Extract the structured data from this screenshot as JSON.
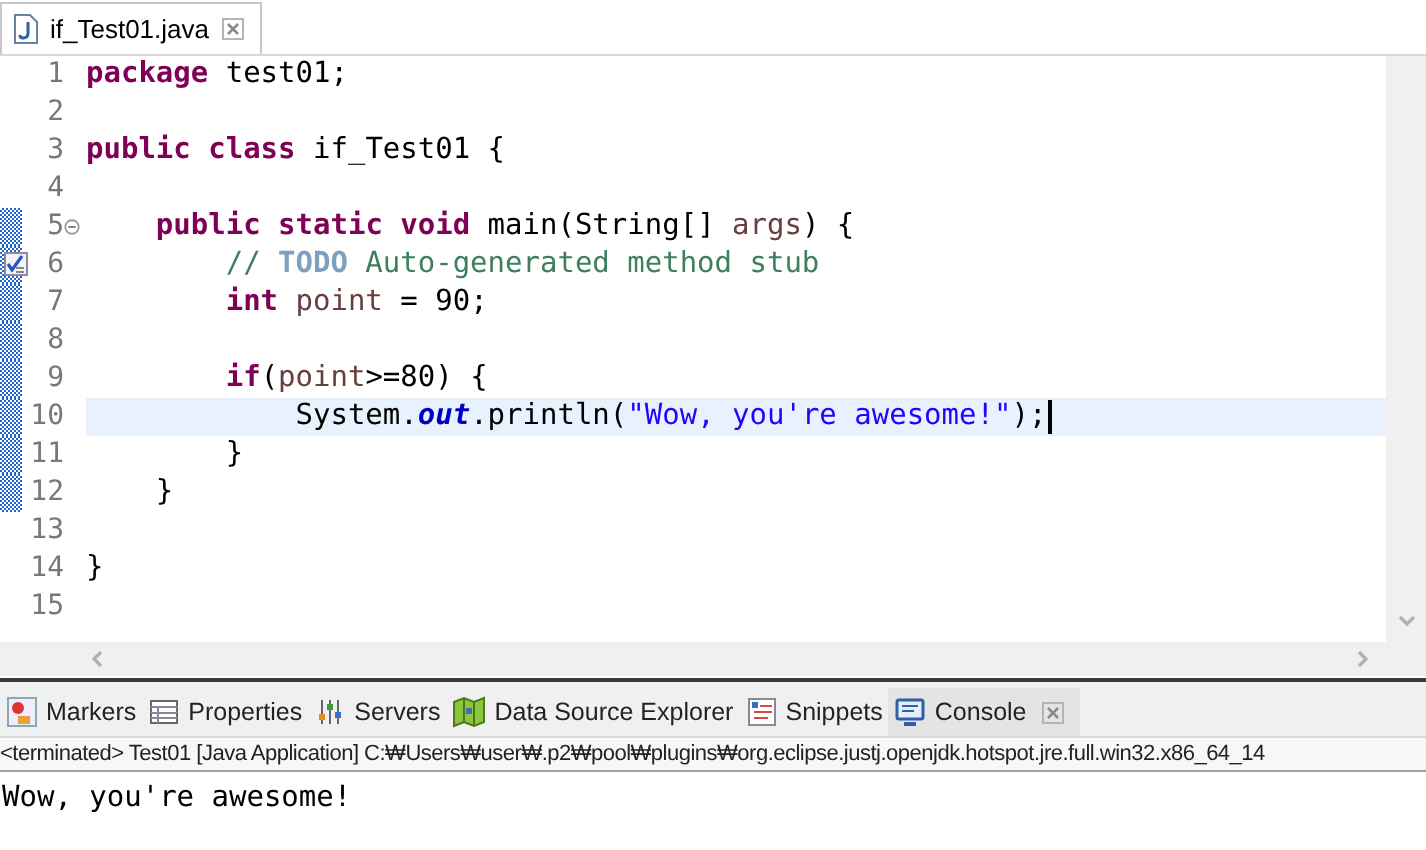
{
  "editor_tab": {
    "title": "if_Test01.java",
    "selected": true
  },
  "code_lines": [
    {
      "number": "1",
      "changed": false,
      "current": false,
      "folding": false,
      "task": false,
      "tokens": [
        {
          "kind": "keyword",
          "text": "package"
        },
        {
          "kind": "plain",
          "text": " test01;"
        }
      ]
    },
    {
      "number": "2",
      "changed": false,
      "current": false,
      "folding": false,
      "task": false
    },
    {
      "number": "3",
      "changed": false,
      "current": false,
      "folding": false,
      "task": false,
      "tokens": [
        {
          "kind": "keyword",
          "text": "public"
        },
        {
          "kind": "keyword",
          "text": " class"
        },
        {
          "kind": "plain",
          "text": " if_Test01 {"
        }
      ]
    },
    {
      "number": "4",
      "changed": false,
      "current": false,
      "folding": false,
      "task": false
    },
    {
      "number": "5",
      "changed": true,
      "current": false,
      "folding": true,
      "task": false,
      "tokens": [
        {
          "kind": "keyword",
          "text": "    public"
        },
        {
          "kind": "keyword",
          "text": " static"
        },
        {
          "kind": "keyword",
          "text": " void"
        },
        {
          "kind": "plain",
          "text": " main(String[] "
        },
        {
          "kind": "param",
          "text": "args"
        },
        {
          "kind": "plain",
          "text": ") {"
        }
      ]
    },
    {
      "number": "6",
      "changed": true,
      "current": false,
      "folding": false,
      "task": true,
      "tokens": [
        {
          "kind": "comment",
          "text": "        // "
        },
        {
          "kind": "todo",
          "text": "TODO"
        },
        {
          "kind": "comment",
          "text": " Auto-generated method stub"
        }
      ]
    },
    {
      "number": "7",
      "changed": true,
      "current": false,
      "folding": false,
      "task": false,
      "tokens": [
        {
          "kind": "keyword",
          "text": "        int"
        },
        {
          "kind": "param",
          "text": " point"
        },
        {
          "kind": "plain",
          "text": " = 90;"
        }
      ]
    },
    {
      "number": "8",
      "changed": true,
      "current": false,
      "folding": false,
      "task": false
    },
    {
      "number": "9",
      "changed": true,
      "current": false,
      "folding": false,
      "task": false,
      "tokens": [
        {
          "kind": "keyword",
          "text": "        if"
        },
        {
          "kind": "plain",
          "text": "("
        },
        {
          "kind": "param",
          "text": "point"
        },
        {
          "kind": "plain",
          "text": ">=80) {"
        }
      ]
    },
    {
      "number": "10",
      "changed": true,
      "current": true,
      "folding": false,
      "task": false,
      "tokens": [
        {
          "kind": "plain",
          "text": "            System."
        },
        {
          "kind": "field",
          "text": "out"
        },
        {
          "kind": "plain",
          "text": ".println("
        },
        {
          "kind": "string",
          "text": "\"Wow, you're awesome!\""
        },
        {
          "kind": "plain",
          "text": ");"
        }
      ]
    },
    {
      "number": "11",
      "changed": true,
      "current": false,
      "folding": false,
      "task": false,
      "tokens": [
        {
          "kind": "plain",
          "text": "        }"
        }
      ]
    },
    {
      "number": "12",
      "changed": true,
      "current": false,
      "folding": false,
      "task": false,
      "tokens": [
        {
          "kind": "plain",
          "text": "    }"
        }
      ]
    },
    {
      "number": "13",
      "changed": false,
      "current": false,
      "folding": false,
      "task": false
    },
    {
      "number": "14",
      "changed": false,
      "current": false,
      "folding": false,
      "task": false,
      "tokens": [
        {
          "kind": "plain",
          "text": "}"
        }
      ]
    },
    {
      "number": "15",
      "changed": false,
      "current": false,
      "folding": false,
      "task": false
    }
  ],
  "panel_tabs": [
    {
      "kind": "markers",
      "label": "Markers",
      "selected": false
    },
    {
      "kind": "properties",
      "label": "Properties",
      "selected": false
    },
    {
      "kind": "servers",
      "label": "Servers",
      "selected": false
    },
    {
      "kind": "datasource",
      "label": "Data Source Explorer",
      "selected": false
    },
    {
      "kind": "snippets",
      "label": "Snippets",
      "selected": false
    },
    {
      "kind": "console",
      "label": "Console",
      "selected": true
    }
  ],
  "console": {
    "header": "<terminated> Test01 [Java Application] C:₩Users₩user₩.p2₩pool₩plugins₩org.eclipse.justj.openjdk.hotspot.jre.full.win32.x86_64_14",
    "output": "Wow, you're awesome!"
  }
}
